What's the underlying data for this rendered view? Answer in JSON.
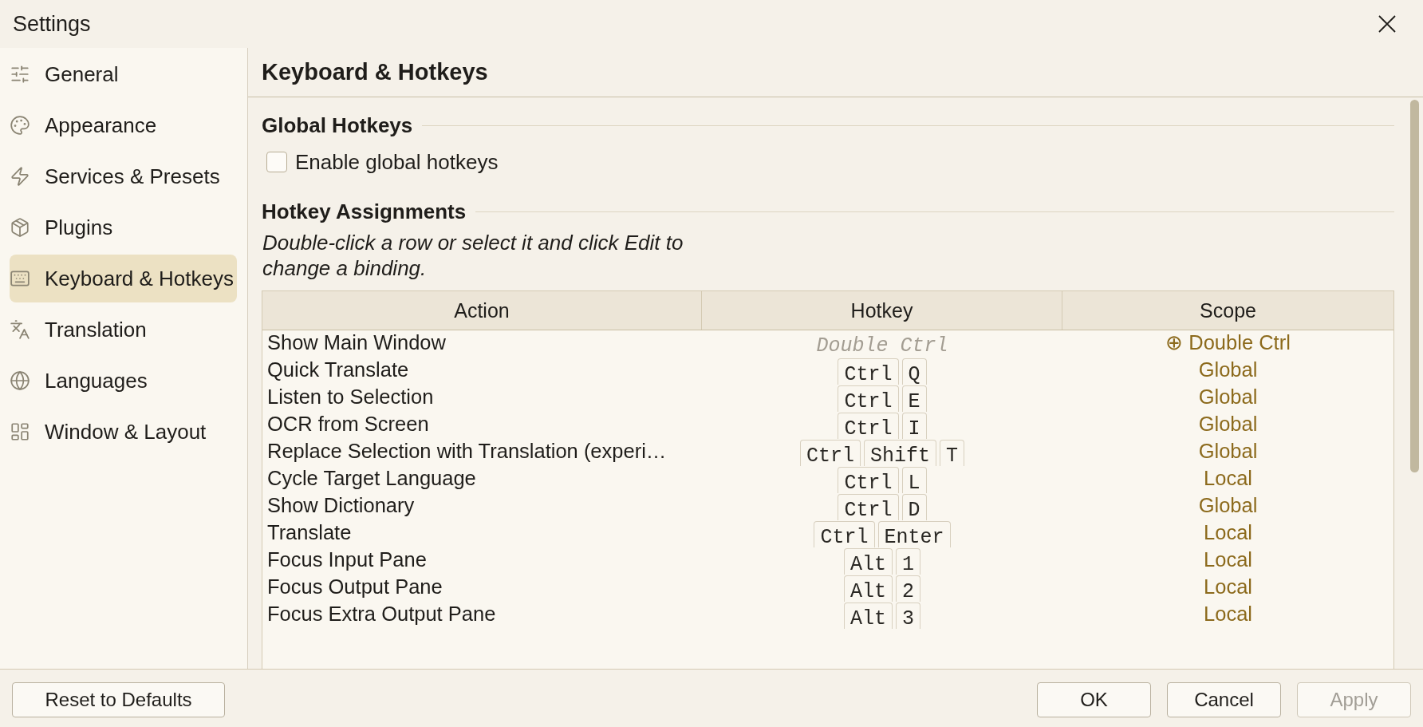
{
  "window": {
    "title": "Settings"
  },
  "sidebar": {
    "items": [
      {
        "label": "General",
        "selected": false
      },
      {
        "label": "Appearance",
        "selected": false
      },
      {
        "label": "Services & Presets",
        "selected": false
      },
      {
        "label": "Plugins",
        "selected": false
      },
      {
        "label": "Keyboard & Hotkeys",
        "selected": true
      },
      {
        "label": "Translation",
        "selected": false
      },
      {
        "label": "Languages",
        "selected": false
      },
      {
        "label": "Window & Layout",
        "selected": false
      }
    ]
  },
  "page": {
    "title": "Keyboard & Hotkeys"
  },
  "global_hotkeys": {
    "heading": "Global Hotkeys",
    "checkbox": {
      "label": "Enable global hotkeys",
      "checked": false
    }
  },
  "hotkey_assignments": {
    "heading": "Hotkey Assignments",
    "hint": "Double-click a row or select it and click Edit to change a binding.",
    "table": {
      "columns": [
        "Action",
        "Hotkey",
        "Scope"
      ],
      "rows": [
        {
          "action": "Show Main Window",
          "hotkey": {
            "kind": "text",
            "text": "Double Ctrl"
          },
          "scope": "⊕ Double Ctrl"
        },
        {
          "action": "Quick Translate",
          "hotkey": {
            "kind": "keys",
            "keys": [
              "Ctrl",
              "Q"
            ]
          },
          "scope": "Global"
        },
        {
          "action": "Listen to Selection",
          "hotkey": {
            "kind": "keys",
            "keys": [
              "Ctrl",
              "E"
            ]
          },
          "scope": "Global"
        },
        {
          "action": "OCR from Screen",
          "hotkey": {
            "kind": "keys",
            "keys": [
              "Ctrl",
              "I"
            ]
          },
          "scope": "Global"
        },
        {
          "action": "Replace Selection with Translation (experi…",
          "hotkey": {
            "kind": "keys",
            "keys": [
              "Ctrl",
              "Shift",
              "T"
            ]
          },
          "scope": "Global"
        },
        {
          "action": "Cycle Target Language",
          "hotkey": {
            "kind": "keys",
            "keys": [
              "Ctrl",
              "L"
            ]
          },
          "scope": "Local"
        },
        {
          "action": "Show Dictionary",
          "hotkey": {
            "kind": "keys",
            "keys": [
              "Ctrl",
              "D"
            ]
          },
          "scope": "Global"
        },
        {
          "action": "Translate",
          "hotkey": {
            "kind": "keys",
            "keys": [
              "Ctrl",
              "Enter"
            ]
          },
          "scope": "Local"
        },
        {
          "action": "Focus Input Pane",
          "hotkey": {
            "kind": "keys",
            "keys": [
              "Alt",
              "1"
            ]
          },
          "scope": "Local"
        },
        {
          "action": "Focus Output Pane",
          "hotkey": {
            "kind": "keys",
            "keys": [
              "Alt",
              "2"
            ]
          },
          "scope": "Local"
        },
        {
          "action": "Focus Extra Output Pane",
          "hotkey": {
            "kind": "keys",
            "keys": [
              "Alt",
              "3"
            ]
          },
          "scope": "Local"
        }
      ]
    }
  },
  "footer": {
    "left": [
      {
        "label": "Reset to Defaults",
        "disabled": false
      }
    ],
    "right": [
      {
        "label": "OK",
        "disabled": false
      },
      {
        "label": "Cancel",
        "disabled": false
      },
      {
        "label": "Apply",
        "disabled": true
      }
    ]
  }
}
